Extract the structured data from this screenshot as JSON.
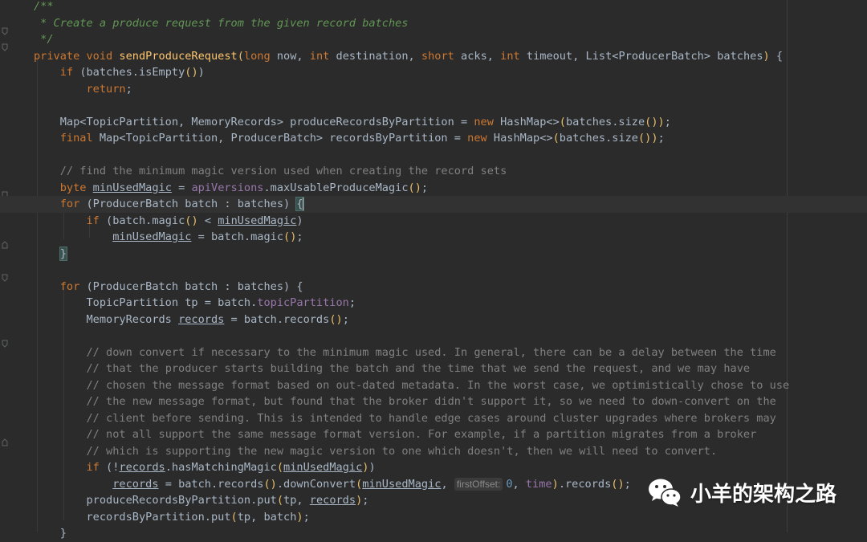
{
  "editor": {
    "lines": [
      {
        "tokens": [
          {
            "t": "/**",
            "c": "jdoc"
          }
        ]
      },
      {
        "tokens": [
          {
            "t": " * Create a produce request from the given record batches",
            "c": "jdoc"
          }
        ]
      },
      {
        "tokens": [
          {
            "t": " */",
            "c": "jdoc"
          }
        ]
      },
      {
        "tokens": [
          {
            "t": "private ",
            "c": "kw"
          },
          {
            "t": "void ",
            "c": "kw"
          },
          {
            "t": "sendProduceRequest",
            "c": "fn"
          },
          {
            "t": "(",
            "c": "paren-y"
          },
          {
            "t": "long ",
            "c": "kw"
          },
          {
            "t": "now, "
          },
          {
            "t": "int ",
            "c": "kw"
          },
          {
            "t": "destination, "
          },
          {
            "t": "short ",
            "c": "kw"
          },
          {
            "t": "acks, "
          },
          {
            "t": "int ",
            "c": "kw"
          },
          {
            "t": "timeout, List<ProducerBatch> batches"
          },
          {
            "t": ")",
            "c": "paren-y"
          },
          {
            "t": " {"
          }
        ]
      },
      {
        "tokens": [
          {
            "t": "    "
          },
          {
            "t": "if ",
            "c": "kw"
          },
          {
            "t": "(batches.isEmpty"
          },
          {
            "t": "()",
            "c": "paren-y"
          },
          {
            "t": ")"
          }
        ]
      },
      {
        "tokens": [
          {
            "t": "        "
          },
          {
            "t": "return",
            "c": "kw"
          },
          {
            "t": ";"
          }
        ]
      },
      {
        "tokens": [
          {
            "t": ""
          }
        ]
      },
      {
        "tokens": [
          {
            "t": "    Map<TopicPartition, MemoryRecords> produceRecordsByPartition = "
          },
          {
            "t": "new ",
            "c": "kw"
          },
          {
            "t": "HashMap<>"
          },
          {
            "t": "(",
            "c": "paren-y"
          },
          {
            "t": "batches.size"
          },
          {
            "t": "()",
            "c": "paren-y"
          },
          {
            "t": ")",
            "c": "paren-y"
          },
          {
            "t": ";"
          }
        ]
      },
      {
        "tokens": [
          {
            "t": "    "
          },
          {
            "t": "final ",
            "c": "kw"
          },
          {
            "t": "Map<TopicPartition, ProducerBatch> recordsByPartition = "
          },
          {
            "t": "new ",
            "c": "kw"
          },
          {
            "t": "HashMap<>"
          },
          {
            "t": "(",
            "c": "paren-y"
          },
          {
            "t": "batches.size"
          },
          {
            "t": "()",
            "c": "paren-y"
          },
          {
            "t": ")",
            "c": "paren-y"
          },
          {
            "t": ";"
          }
        ]
      },
      {
        "tokens": [
          {
            "t": ""
          }
        ]
      },
      {
        "tokens": [
          {
            "t": "    "
          },
          {
            "t": "// find the minimum magic version used when creating the record sets",
            "c": "cm"
          }
        ]
      },
      {
        "tokens": [
          {
            "t": "    "
          },
          {
            "t": "byte ",
            "c": "kw"
          },
          {
            "t": "minUsedMagic",
            "c": "var-ul"
          },
          {
            "t": " = "
          },
          {
            "t": "apiVersions",
            "c": "field"
          },
          {
            "t": ".maxUsableProduceMagic"
          },
          {
            "t": "()",
            "c": "paren-y"
          },
          {
            "t": ";"
          }
        ]
      },
      {
        "tokens": [
          {
            "t": "    "
          },
          {
            "t": "for ",
            "c": "kw"
          },
          {
            "t": "(ProducerBatch batch : batches) "
          },
          {
            "t": "{",
            "c": "brace-hl"
          }
        ],
        "current": true,
        "caret": true
      },
      {
        "tokens": [
          {
            "t": "        "
          },
          {
            "t": "if ",
            "c": "kw"
          },
          {
            "t": "(batch.magic"
          },
          {
            "t": "()",
            "c": "paren-y"
          },
          {
            "t": " < "
          },
          {
            "t": "minUsedMagic",
            "c": "var-ul"
          },
          {
            "t": ")"
          }
        ]
      },
      {
        "tokens": [
          {
            "t": "            "
          },
          {
            "t": "minUsedMagic",
            "c": "var-ul"
          },
          {
            "t": " = batch.magic"
          },
          {
            "t": "()",
            "c": "paren-y"
          },
          {
            "t": ";"
          }
        ]
      },
      {
        "tokens": [
          {
            "t": "    "
          },
          {
            "t": "}",
            "c": "brace-hl"
          }
        ]
      },
      {
        "tokens": [
          {
            "t": ""
          }
        ]
      },
      {
        "tokens": [
          {
            "t": "    "
          },
          {
            "t": "for ",
            "c": "kw"
          },
          {
            "t": "(ProducerBatch batch : batches) {"
          }
        ]
      },
      {
        "tokens": [
          {
            "t": "        TopicPartition tp = batch."
          },
          {
            "t": "topicPartition",
            "c": "field"
          },
          {
            "t": ";"
          }
        ]
      },
      {
        "tokens": [
          {
            "t": "        MemoryRecords "
          },
          {
            "t": "records",
            "c": "var-ul"
          },
          {
            "t": " = batch.records"
          },
          {
            "t": "()",
            "c": "paren-y"
          },
          {
            "t": ";"
          }
        ]
      },
      {
        "tokens": [
          {
            "t": ""
          }
        ]
      },
      {
        "tokens": [
          {
            "t": "        "
          },
          {
            "t": "// down convert if necessary to the minimum magic used. In general, there can be a delay between the time",
            "c": "cm"
          }
        ]
      },
      {
        "tokens": [
          {
            "t": "        "
          },
          {
            "t": "// that the producer starts building the batch and the time that we send the request, and we may have",
            "c": "cm"
          }
        ]
      },
      {
        "tokens": [
          {
            "t": "        "
          },
          {
            "t": "// chosen the message format based on out-dated metadata. In the worst case, we optimistically chose to use",
            "c": "cm"
          }
        ]
      },
      {
        "tokens": [
          {
            "t": "        "
          },
          {
            "t": "// the new message format, but found that the broker didn't support it, so we need to down-convert on the",
            "c": "cm"
          }
        ]
      },
      {
        "tokens": [
          {
            "t": "        "
          },
          {
            "t": "// client before sending. This is intended to handle edge cases around cluster upgrades where brokers may",
            "c": "cm"
          }
        ]
      },
      {
        "tokens": [
          {
            "t": "        "
          },
          {
            "t": "// not all support the same message format version. For example, if a partition migrates from a broker",
            "c": "cm"
          }
        ]
      },
      {
        "tokens": [
          {
            "t": "        "
          },
          {
            "t": "// which is supporting the new magic version to one which doesn't, then we will need to convert.",
            "c": "cm"
          }
        ]
      },
      {
        "tokens": [
          {
            "t": "        "
          },
          {
            "t": "if ",
            "c": "kw"
          },
          {
            "t": "(!"
          },
          {
            "t": "records",
            "c": "var-ul"
          },
          {
            "t": ".hasMatchingMagic"
          },
          {
            "t": "(",
            "c": "paren-y"
          },
          {
            "t": "minUsedMagic",
            "c": "var-ul"
          },
          {
            "t": ")",
            "c": "paren-y"
          },
          {
            "t": ")"
          }
        ]
      },
      {
        "tokens": [
          {
            "t": "            "
          },
          {
            "t": "records",
            "c": "var-ul"
          },
          {
            "t": " = batch.records"
          },
          {
            "t": "()",
            "c": "paren-y"
          },
          {
            "t": ".downConvert"
          },
          {
            "t": "(",
            "c": "paren-y"
          },
          {
            "t": "minUsedMagic",
            "c": "var-ul"
          },
          {
            "t": ", "
          },
          {
            "t": "firstOffset:",
            "c": "hint"
          },
          {
            "t": "0",
            "c": "num"
          },
          {
            "t": ", "
          },
          {
            "t": "time",
            "c": "field"
          },
          {
            "t": ")",
            "c": "paren-y"
          },
          {
            "t": ".records"
          },
          {
            "t": "()",
            "c": "paren-y"
          },
          {
            "t": ";"
          }
        ]
      },
      {
        "tokens": [
          {
            "t": "        produceRecordsByPartition.put"
          },
          {
            "t": "(",
            "c": "paren-y"
          },
          {
            "t": "tp, "
          },
          {
            "t": "records",
            "c": "var-ul"
          },
          {
            "t": ")",
            "c": "paren-y"
          },
          {
            "t": ";"
          }
        ]
      },
      {
        "tokens": [
          {
            "t": "        recordsByPartition.put"
          },
          {
            "t": "(",
            "c": "paren-y"
          },
          {
            "t": "tp, batch"
          },
          {
            "t": ")",
            "c": "paren-y"
          },
          {
            "t": ";"
          }
        ]
      },
      {
        "tokens": [
          {
            "t": "    }"
          }
        ]
      }
    ]
  },
  "watermark": {
    "text": "小羊的架构之路",
    "icon": "wechat-icon"
  },
  "colors": {
    "background": "#2b2b2b",
    "keyword": "#cc7832",
    "function": "#ffc66d",
    "comment": "#808080",
    "javadoc": "#629755",
    "field": "#9876aa",
    "number": "#6897bb",
    "text": "#a9b7c6"
  }
}
